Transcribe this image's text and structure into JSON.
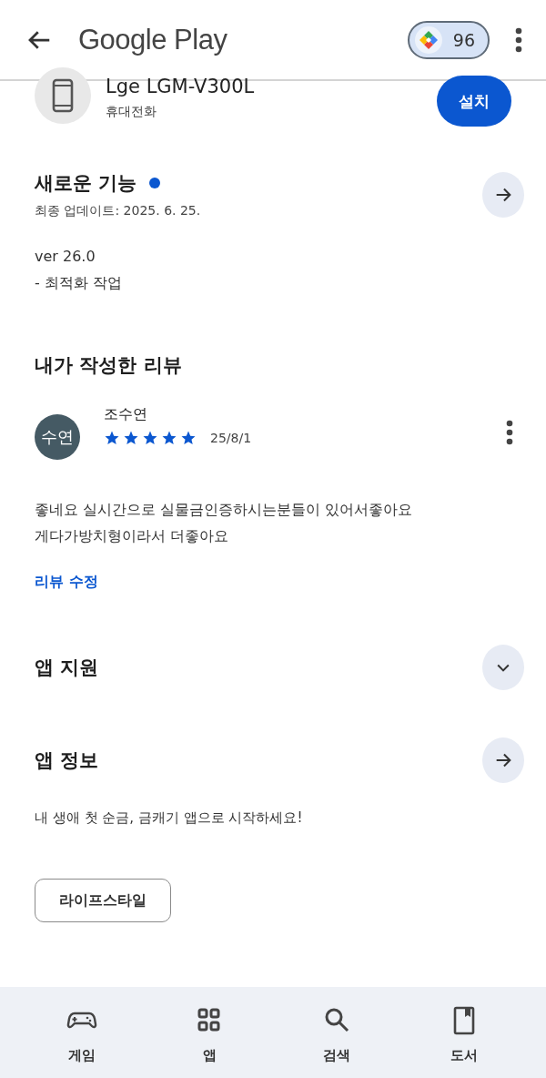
{
  "header": {
    "title": "Google Play",
    "points": "96"
  },
  "app": {
    "name": "Lge LGM-V300L",
    "category": "휴대전화",
    "install": "설치"
  },
  "whats_new": {
    "title": "새로운 기능",
    "new": true,
    "updated": "최종 업데이트: 2025. 6. 25.",
    "lines": [
      "ver 26.0",
      "- 최적화 작업"
    ]
  },
  "my_review": {
    "title": "내가 작성한 리뷰",
    "avatar": "수연",
    "author": "조수연",
    "stars": 5,
    "date": "25/8/1",
    "lines": [
      "좋네요 실시간으로 실물금인증하시는분들이 있어서좋아요",
      "게다가방치형이라서 더좋아요"
    ],
    "edit": "리뷰 수정"
  },
  "sections": [
    {
      "title": "앱 지원",
      "kind": "expand"
    },
    {
      "title": "앱 정보",
      "kind": "arrow",
      "description": "내 생애 첫 순금, 금캐기 앱으로 시작하세요!"
    }
  ],
  "tag": "라이프스타일",
  "nav": [
    {
      "label": "게임",
      "kind": "game"
    },
    {
      "label": "앱",
      "kind": "apps"
    },
    {
      "label": "검색",
      "kind": "search"
    },
    {
      "label": "도서",
      "kind": "book"
    }
  ]
}
